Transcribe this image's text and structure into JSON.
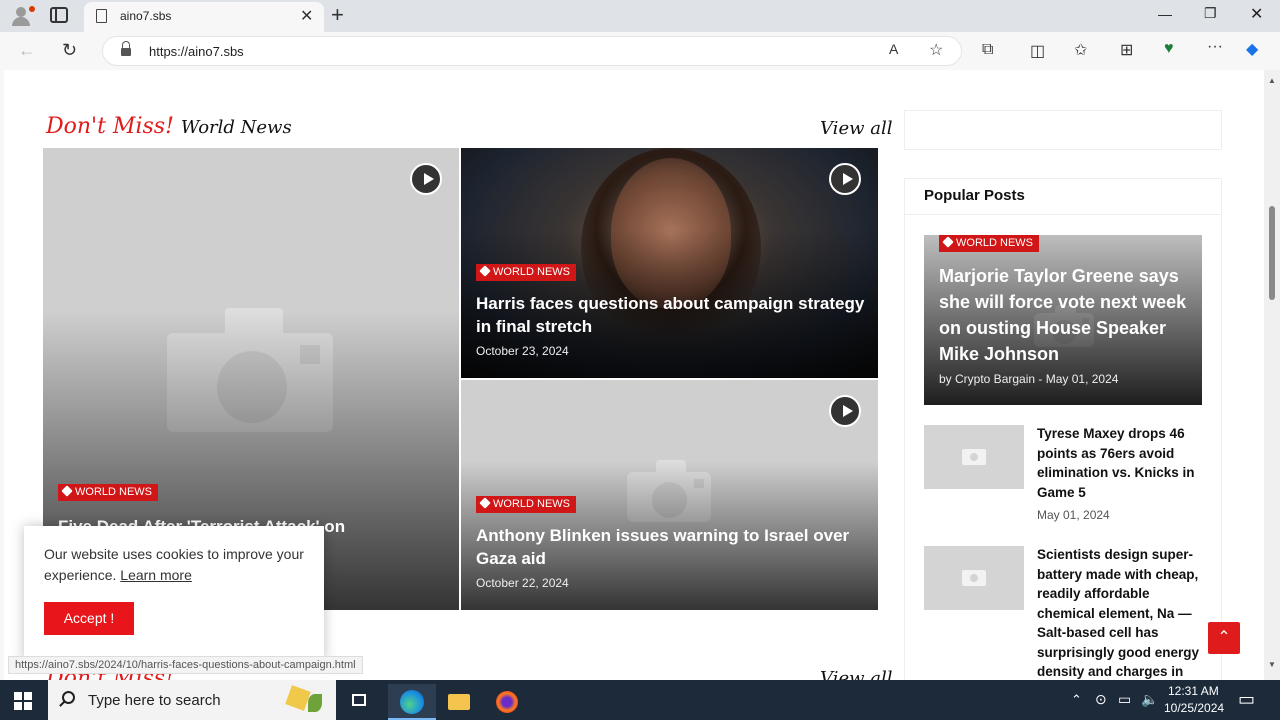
{
  "browser": {
    "tab_title": "aino7.sbs",
    "url": "https://aino7.sbs",
    "status_url": "https://aino7.sbs/2024/10/harris-faces-questions-about-campaign.html"
  },
  "section": {
    "title_red": "Don't Miss!",
    "title_black": "World News",
    "view_all": "View all"
  },
  "cards": [
    {
      "category": "WORLD NEWS",
      "headline": "Five Dead After 'Terrorist Attack' on",
      "date": ""
    },
    {
      "category": "WORLD NEWS",
      "headline": "Harris faces questions about campaign strategy in final stretch",
      "date": "October 23, 2024"
    },
    {
      "category": "WORLD NEWS",
      "headline": "Anthony Blinken issues warning to Israel over Gaza aid",
      "date": "October 22, 2024"
    }
  ],
  "sidebar": {
    "popular_title": "Popular Posts",
    "featured": {
      "category": "WORLD NEWS",
      "headline": "Marjorie Taylor Greene says she will force vote next week on ousting House Speaker Mike Johnson",
      "meta": "by Crypto Bargain - May 01, 2024"
    },
    "posts": [
      {
        "title": "Tyrese Maxey drops 46 points as 76ers avoid elimination vs. Knicks in Game 5",
        "date": "May 01, 2024"
      },
      {
        "title": "Scientists design super-battery made with cheap, readily affordable chemical element, Na — Salt-based cell has surprisingly good energy density and charges in seconds",
        "date": ""
      }
    ]
  },
  "cookie": {
    "text": "Our website uses cookies to improve your experience.",
    "learn_more": "Learn more",
    "accept": "Accept !"
  },
  "bottom": {
    "title": "Don't Miss!",
    "view_all": "View all"
  },
  "taskbar": {
    "search_placeholder": "Type here to search",
    "time": "12:31 AM",
    "date": "10/25/2024"
  },
  "colors": {
    "accent": "#e01b1b",
    "taskbar": "#1c2a3a"
  }
}
